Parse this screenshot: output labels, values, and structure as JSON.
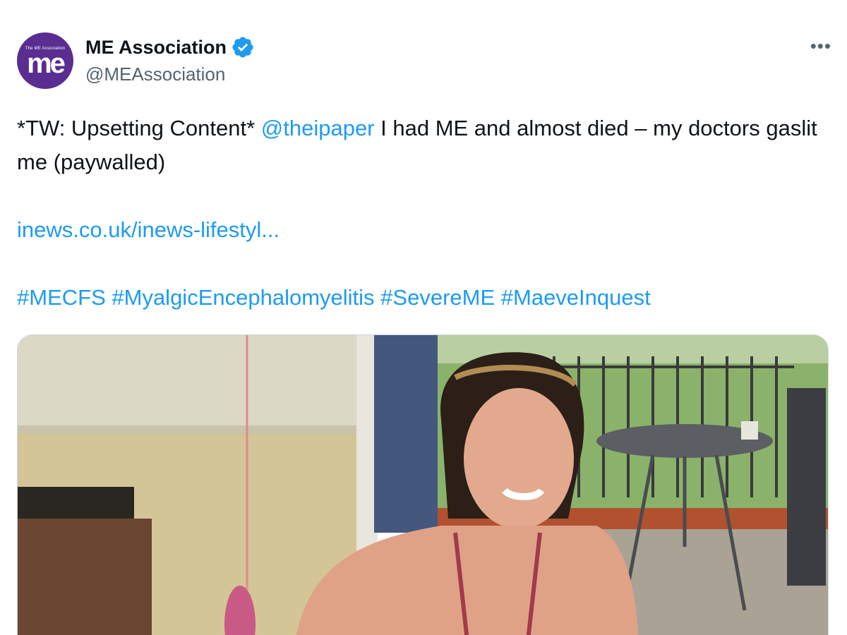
{
  "author": {
    "name": "ME Association",
    "handle": "@MEAssociation",
    "avatar_tag": "The ME Association",
    "avatar_mark": "me",
    "verified": true
  },
  "more_icon": "ellipsis-icon",
  "tweet": {
    "line_1_prefix": "*TW: Upsetting Content* ",
    "mention": "@theipaper",
    "line_1_suffix": " I had ME and almost died – my doctors gaslit me (paywalled)",
    "url": "inews.co.uk/inews-lifestyl...",
    "hashtags": [
      "#MECFS",
      "#MyalgicEncephalomyelitis",
      "#SevereME",
      "#MaeveInquest"
    ]
  },
  "colors": {
    "link": "#1d9bf0",
    "text": "#0f1419",
    "secondary": "#536471",
    "avatar_bg": "#5a2d91",
    "verified": "#1d9bf0"
  }
}
